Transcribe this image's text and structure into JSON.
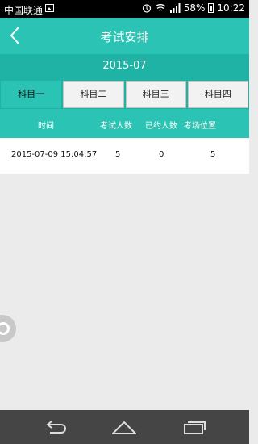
{
  "status": {
    "carrier": "中国联通",
    "battery": "58%",
    "time": "10:22"
  },
  "header": {
    "title": "考试安排"
  },
  "month": "2015-07",
  "tabs": [
    {
      "label": "科目一",
      "active": true
    },
    {
      "label": "科目二",
      "active": false
    },
    {
      "label": "科目三",
      "active": false
    },
    {
      "label": "科目四",
      "active": false
    }
  ],
  "table": {
    "columns": [
      "时间",
      "考试人数",
      "已约人数",
      "考场位置"
    ],
    "rows": [
      {
        "time": "2015-07-09 15:04:57",
        "exam_count": "5",
        "booked": "0",
        "location": "5"
      }
    ]
  },
  "colors": {
    "accent": "#2bc4b4",
    "accent_dark": "#1fb3a5",
    "nav_bar": "#454545"
  },
  "icons": {
    "back": "chevron-left-icon",
    "alarm": "alarm-icon",
    "wifi": "wifi-icon",
    "signal": "signal-icon",
    "battery": "battery-icon",
    "nav_back": "nav-back-icon",
    "nav_home": "nav-home-icon",
    "nav_recent": "nav-recent-icon"
  }
}
